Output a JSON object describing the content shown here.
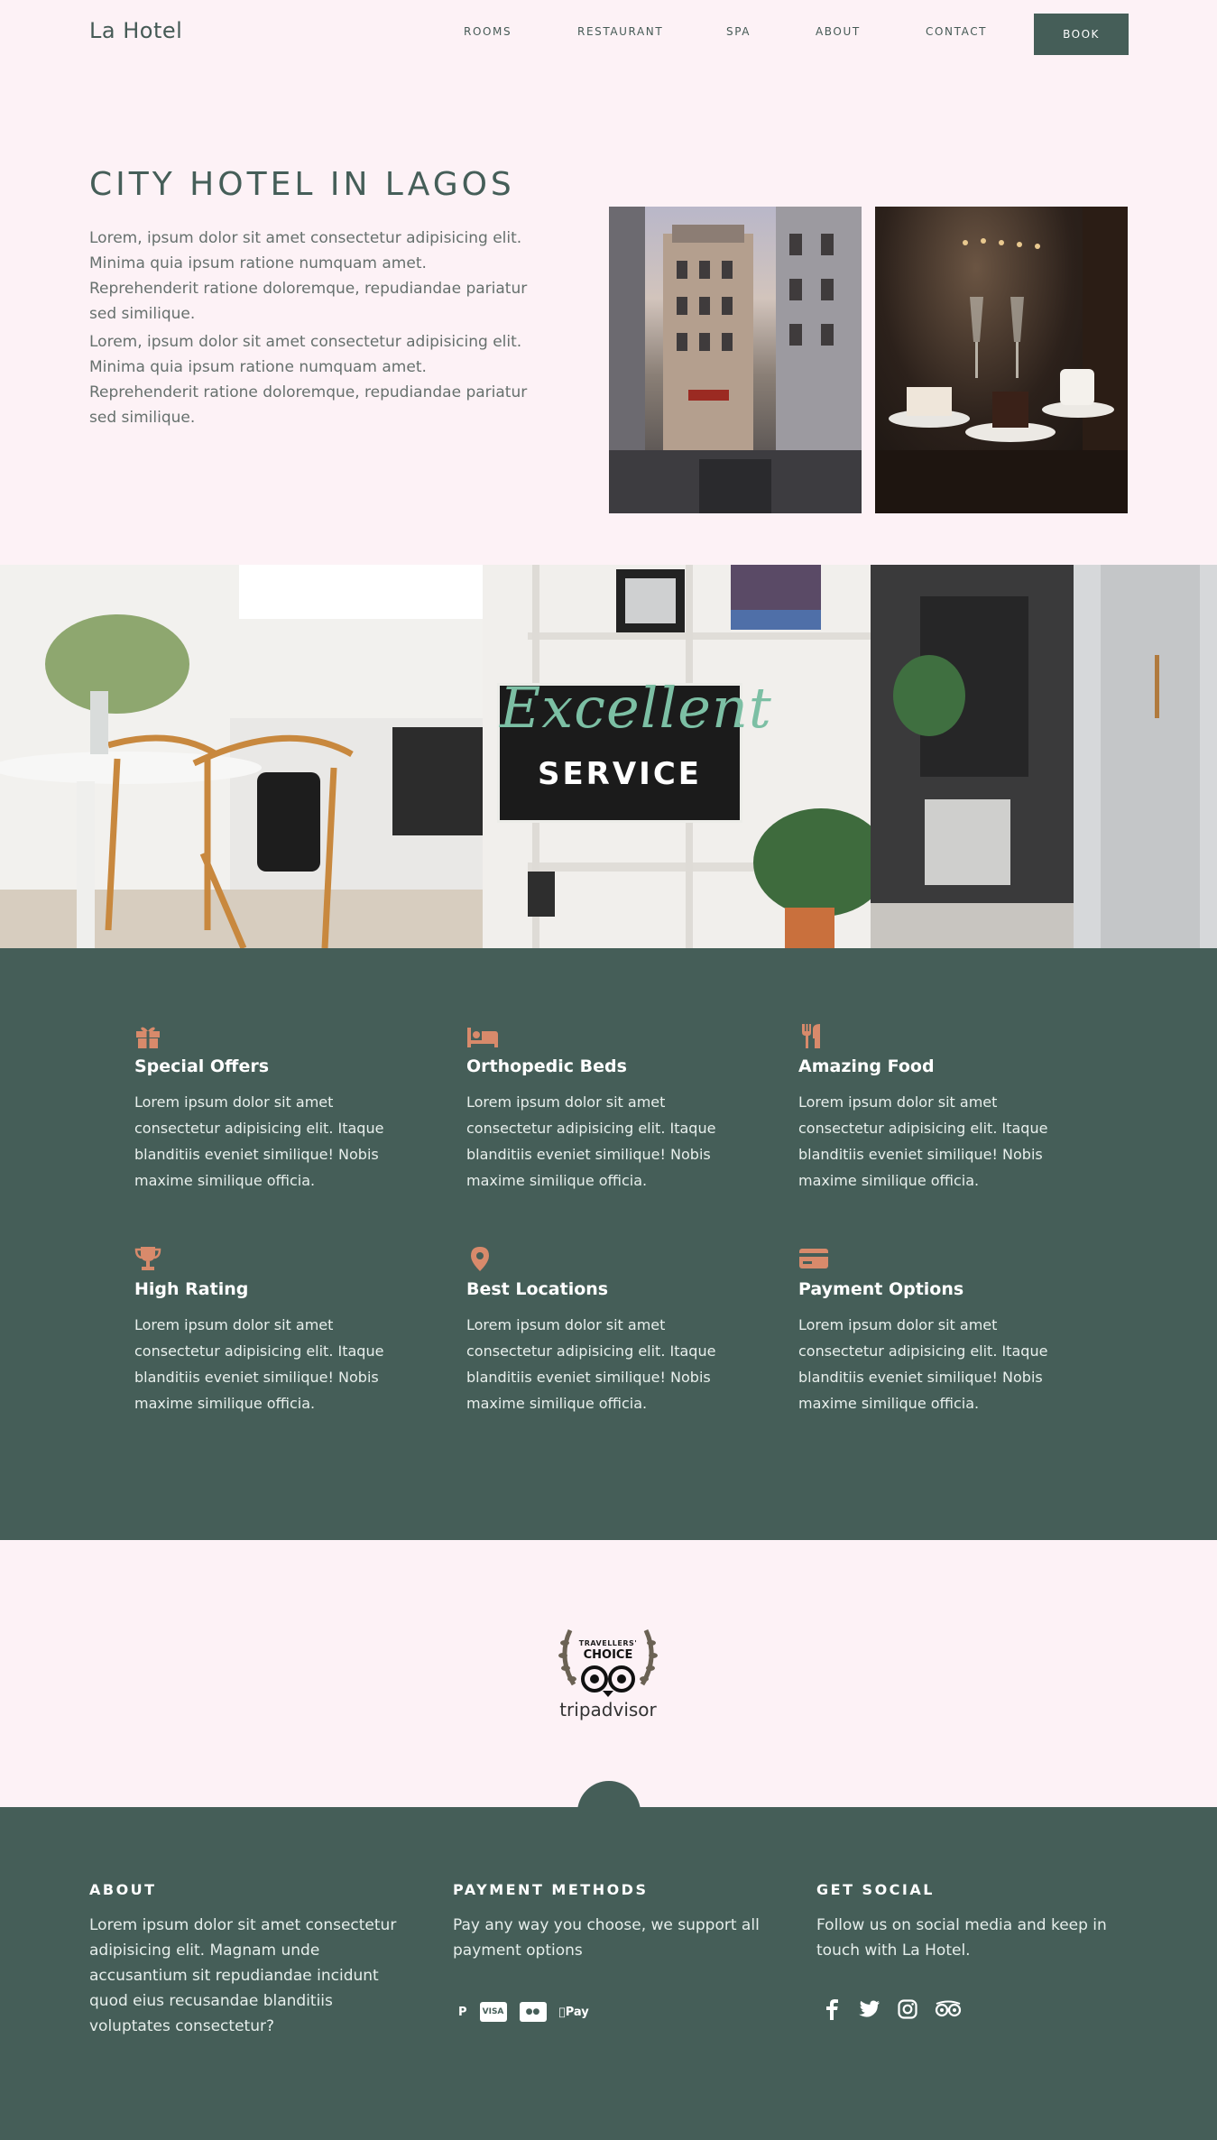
{
  "brand": {
    "name": "La Hotel"
  },
  "nav": {
    "items": [
      {
        "label": "ROOMS"
      },
      {
        "label": "RESTAURANT"
      },
      {
        "label": "SPA"
      },
      {
        "label": "ABOUT"
      },
      {
        "label": "CONTACT"
      }
    ],
    "cta": "BOOK"
  },
  "hero": {
    "title": "CITY HOTEL IN LAGOS",
    "paragraphs": [
      "Lorem, ipsum dolor sit amet consectetur adipisicing elit. Minima quia ipsum ratione numquam amet. Reprehenderit ratione doloremque, repudiandae pariatur sed similique.",
      "Lorem, ipsum dolor sit amet consectetur adipisicing elit. Minima quia ipsum ratione numquam amet. Reprehenderit ratione doloremque, repudiandae pariatur sed similique."
    ],
    "images": [
      "city-street-photo",
      "cafe-dessert-photo"
    ]
  },
  "banner": {
    "script": "Excellent",
    "word": "SERVICE"
  },
  "features": [
    {
      "icon": "gift-icon",
      "title": "Special Offers",
      "text": "Lorem ipsum dolor sit amet consectetur adipisicing elit. Itaque blanditiis eveniet similique! Nobis maxime similique officia."
    },
    {
      "icon": "bed-icon",
      "title": "Orthopedic Beds",
      "text": "Lorem ipsum dolor sit amet consectetur adipisicing elit. Itaque blanditiis eveniet similique! Nobis maxime similique officia."
    },
    {
      "icon": "utensils-icon",
      "title": "Amazing Food",
      "text": "Lorem ipsum dolor sit amet consectetur adipisicing elit. Itaque blanditiis eveniet similique! Nobis maxime similique officia."
    },
    {
      "icon": "trophy-icon",
      "title": "High Rating",
      "text": "Lorem ipsum dolor sit amet consectetur adipisicing elit. Itaque blanditiis eveniet similique! Nobis maxime similique officia."
    },
    {
      "icon": "map-pin-icon",
      "title": "Best Locations",
      "text": "Lorem ipsum dolor sit amet consectetur adipisicing elit. Itaque blanditiis eveniet similique! Nobis maxime similique officia."
    },
    {
      "icon": "credit-card-icon",
      "title": "Payment Options",
      "text": "Lorem ipsum dolor sit amet consectetur adipisicing elit. Itaque blanditiis eveniet similique! Nobis maxime similique officia."
    }
  ],
  "award": {
    "line1": "TRAVELLERS'",
    "line2": "CHOICE",
    "brand": "tripadvisor"
  },
  "footer": {
    "about": {
      "title": "ABOUT",
      "text": "Lorem ipsum dolor sit amet consectetur adipisicing elit. Magnam unde accusantium sit repudiandae incidunt quod eius recusandae blanditiis voluptates consectetur?"
    },
    "payment": {
      "title": "PAYMENT METHODS",
      "text": "Pay any way you choose, we support all payment options",
      "methods": [
        {
          "icon": "paypal-icon",
          "label": "P"
        },
        {
          "icon": "visa-icon",
          "label": "VISA"
        },
        {
          "icon": "mastercard-icon",
          "label": "●●"
        },
        {
          "icon": "apple-pay-icon",
          "label": "Pay"
        }
      ]
    },
    "social": {
      "title": "GET SOCIAL",
      "text": "Follow us on social media and keep in touch with La Hotel.",
      "links": [
        "facebook-icon",
        "twitter-icon",
        "instagram-icon",
        "tripadvisor-icon"
      ]
    }
  },
  "colors": {
    "primary": "#455e58",
    "accent": "#d88a6b",
    "background": "#fdf2f6"
  }
}
